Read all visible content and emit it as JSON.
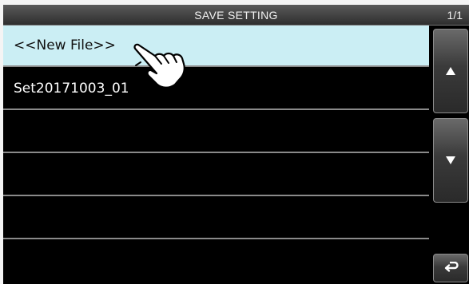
{
  "header": {
    "title": "SAVE SETTING",
    "page": "1/1"
  },
  "list": {
    "items": [
      {
        "label": "<<New File>>",
        "selected": true
      },
      {
        "label": "Set20171003_01",
        "selected": false
      },
      {
        "label": "",
        "selected": false
      },
      {
        "label": "",
        "selected": false
      },
      {
        "label": "",
        "selected": false
      },
      {
        "label": "",
        "selected": false
      }
    ]
  },
  "side_buttons": {
    "up_icon": "triangle-up-icon",
    "down_icon": "triangle-down-icon",
    "back_icon": "return-arrow-icon"
  },
  "colors": {
    "selected_row": "#cbeef4",
    "background": "#000000",
    "divider": "#8a8a8a"
  }
}
